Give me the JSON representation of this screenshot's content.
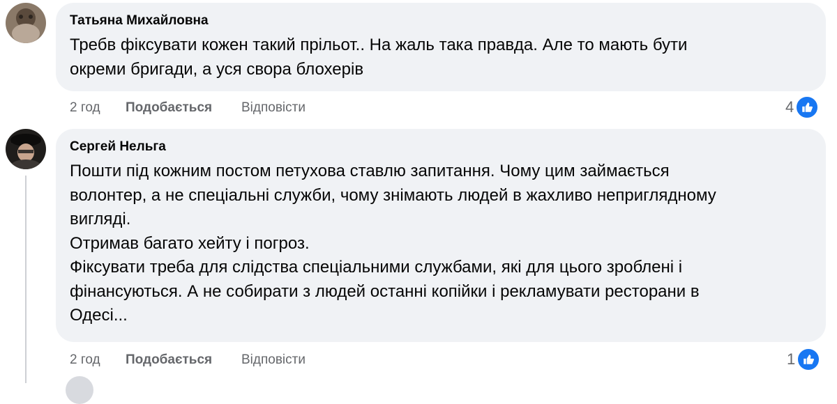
{
  "comments": [
    {
      "author": "Татьяна Михайловна",
      "lines": [
        "Требв фіксувати кожен такий прільот.. На жаль така правда. Але то мають бути",
        "окреми бригади, а уся свора блохерів"
      ],
      "time": "2 год",
      "like_label": "Подобається",
      "reply_label": "Відповісти",
      "reaction_count": "4",
      "avatar_icon": "user-avatar-photo"
    },
    {
      "author": "Сергей Нельга",
      "lines": [
        "Пошти під кожним постом петухова ставлю запитання. Чому цим займається",
        "волонтер, а не спеціальні служби, чому знімають людей в жахливо неприглядному",
        "вигляді.",
        "Отримав багато хейту і погроз.",
        "Фіксувати треба для слідства спеціальними службами, які для цього зроблені і",
        "фінансуються. А не собирати з людей останні копійки і рекламувати ресторани в",
        "Одесі..."
      ],
      "time": "2 год",
      "like_label": "Подобається",
      "reply_label": "Відповісти",
      "reaction_count": "1",
      "avatar_icon": "user-avatar-photo"
    }
  ],
  "colors": {
    "bubble": "#f0f2f5",
    "meta_text": "#65676b",
    "like_blue": "#1877f2"
  }
}
